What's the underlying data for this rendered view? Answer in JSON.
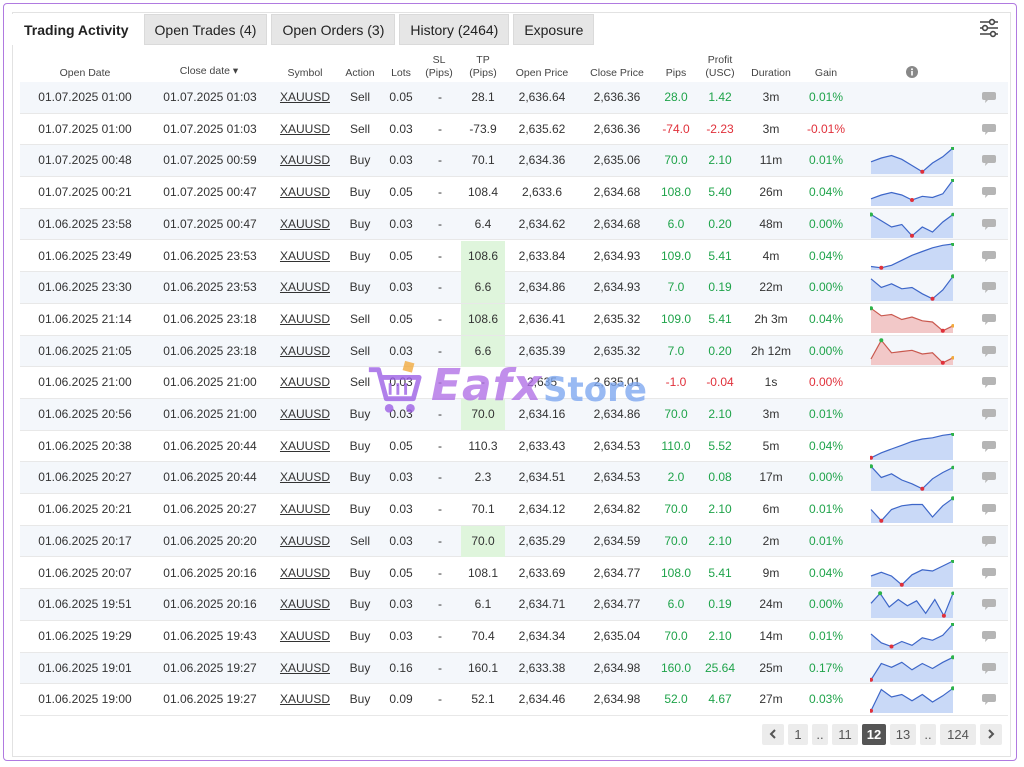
{
  "tabs": [
    {
      "label": "Trading Activity",
      "active": true
    },
    {
      "label": "Open Trades (4)",
      "active": false
    },
    {
      "label": "Open Orders (3)",
      "active": false
    },
    {
      "label": "History (2464)",
      "active": false
    },
    {
      "label": "Exposure",
      "active": false
    }
  ],
  "filter_icon": "sliders-icon",
  "columns": {
    "open_date": "Open Date",
    "close_date": "Close date ▾",
    "symbol": "Symbol",
    "action": "Action",
    "lots": "Lots",
    "sl_1": "SL",
    "sl_2": "(Pips)",
    "tp_1": "TP",
    "tp_2": "(Pips)",
    "open_price": "Open Price",
    "close_price": "Close Price",
    "pips": "Pips",
    "profit_1": "Profit",
    "profit_2": "(USC)",
    "duration": "Duration",
    "gain": "Gain",
    "info_icon": "info-icon"
  },
  "rows": [
    {
      "open": "01.07.2025 01:00",
      "close": "01.07.2025 01:03",
      "symbol": "XAUUSD",
      "action": "Sell",
      "lots": "0.05",
      "sl": "-",
      "tp": "28.1",
      "open_price": "2,636.64",
      "close_price": "2,636.36",
      "pips": "28.0",
      "profit": "1.42",
      "duration": "3m",
      "gain": "0.01%",
      "sign": "pos",
      "tp_hl": false,
      "spark": null
    },
    {
      "open": "01.07.2025 01:00",
      "close": "01.07.2025 01:03",
      "symbol": "XAUUSD",
      "action": "Sell",
      "lots": "0.03",
      "sl": "-",
      "tp": "-73.9",
      "open_price": "2,635.62",
      "close_price": "2,636.36",
      "pips": "-74.0",
      "profit": "-2.23",
      "duration": "3m",
      "gain": "-0.01%",
      "sign": "neg",
      "tp_hl": false,
      "spark": null
    },
    {
      "open": "01.07.2025 00:48",
      "close": "01.07.2025 00:59",
      "symbol": "XAUUSD",
      "action": "Buy",
      "lots": "0.03",
      "sl": "-",
      "tp": "70.1",
      "open_price": "2,634.36",
      "close_price": "2,635.06",
      "pips": "70.0",
      "profit": "2.10",
      "duration": "11m",
      "gain": "0.01%",
      "sign": "pos",
      "tp_hl": false,
      "spark": {
        "dir": "up",
        "points": [
          0.55,
          0.4,
          0.3,
          0.45,
          0.7,
          0.95,
          0.6,
          0.35,
          0.0
        ]
      }
    },
    {
      "open": "01.07.2025 00:21",
      "close": "01.07.2025 00:47",
      "symbol": "XAUUSD",
      "action": "Buy",
      "lots": "0.05",
      "sl": "-",
      "tp": "108.4",
      "open_price": "2,633.6",
      "close_price": "2,634.68",
      "pips": "108.0",
      "profit": "5.40",
      "duration": "26m",
      "gain": "0.04%",
      "sign": "pos",
      "tp_hl": false,
      "spark": {
        "dir": "up",
        "points": [
          0.75,
          0.6,
          0.5,
          0.6,
          0.8,
          0.65,
          0.7,
          0.55,
          0.0
        ]
      }
    },
    {
      "open": "01.06.2025 23:58",
      "close": "01.07.2025 00:47",
      "symbol": "XAUUSD",
      "action": "Buy",
      "lots": "0.03",
      "sl": "-",
      "tp": "6.4",
      "open_price": "2,634.62",
      "close_price": "2,634.68",
      "pips": "6.0",
      "profit": "0.20",
      "duration": "48m",
      "gain": "0.00%",
      "sign": "pos",
      "tp_hl": false,
      "spark": {
        "dir": "flat",
        "points": [
          0.1,
          0.35,
          0.6,
          0.5,
          0.95,
          0.6,
          0.8,
          0.4,
          0.1
        ]
      }
    },
    {
      "open": "01.06.2025 23:49",
      "close": "01.06.2025 23:53",
      "symbol": "XAUUSD",
      "action": "Buy",
      "lots": "0.05",
      "sl": "-",
      "tp": "108.6",
      "open_price": "2,633.84",
      "close_price": "2,634.93",
      "pips": "109.0",
      "profit": "5.41",
      "duration": "4m",
      "gain": "0.04%",
      "sign": "pos",
      "tp_hl": true,
      "spark": {
        "dir": "up",
        "points": [
          0.9,
          0.95,
          0.85,
          0.65,
          0.45,
          0.3,
          0.15,
          0.05,
          0.0
        ]
      }
    },
    {
      "open": "01.06.2025 23:30",
      "close": "01.06.2025 23:53",
      "symbol": "XAUUSD",
      "action": "Buy",
      "lots": "0.03",
      "sl": "-",
      "tp": "6.6",
      "open_price": "2,634.86",
      "close_price": "2,634.93",
      "pips": "7.0",
      "profit": "0.19",
      "duration": "22m",
      "gain": "0.00%",
      "sign": "pos",
      "tp_hl": true,
      "spark": {
        "dir": "up",
        "points": [
          0.15,
          0.5,
          0.35,
          0.55,
          0.5,
          0.75,
          0.95,
          0.6,
          0.05
        ]
      }
    },
    {
      "open": "01.06.2025 21:14",
      "close": "01.06.2025 23:18",
      "symbol": "XAUUSD",
      "action": "Sell",
      "lots": "0.05",
      "sl": "-",
      "tp": "108.6",
      "open_price": "2,636.41",
      "close_price": "2,635.32",
      "pips": "109.0",
      "profit": "5.41",
      "duration": "2h 3m",
      "gain": "0.04%",
      "sign": "pos",
      "tp_hl": true,
      "spark": {
        "dir": "down",
        "points": [
          0.05,
          0.35,
          0.3,
          0.5,
          0.4,
          0.55,
          0.6,
          0.95,
          0.75
        ]
      }
    },
    {
      "open": "01.06.2025 21:05",
      "close": "01.06.2025 23:18",
      "symbol": "XAUUSD",
      "action": "Sell",
      "lots": "0.03",
      "sl": "-",
      "tp": "6.6",
      "open_price": "2,635.39",
      "close_price": "2,635.32",
      "pips": "7.0",
      "profit": "0.20",
      "duration": "2h 12m",
      "gain": "0.00%",
      "sign": "pos",
      "tp_hl": true,
      "spark": {
        "dir": "down",
        "points": [
          0.8,
          0.05,
          0.55,
          0.5,
          0.45,
          0.6,
          0.55,
          0.95,
          0.75
        ]
      }
    },
    {
      "open": "01.06.2025 21:00",
      "close": "01.06.2025 21:00",
      "symbol": "XAUUSD",
      "action": "Sell",
      "lots": "0.03",
      "sl": "-",
      "tp": "-",
      "open_price": "2,635",
      "close_price": "2,635.01",
      "pips": "-1.0",
      "profit": "-0.04",
      "duration": "1s",
      "gain": "0.00%",
      "sign": "neg",
      "tp_hl": false,
      "spark": null
    },
    {
      "open": "01.06.2025 20:56",
      "close": "01.06.2025 21:00",
      "symbol": "XAUUSD",
      "action": "Buy",
      "lots": "0.03",
      "sl": "-",
      "tp": "70.0",
      "open_price": "2,634.16",
      "close_price": "2,634.86",
      "pips": "70.0",
      "profit": "2.10",
      "duration": "3m",
      "gain": "0.01%",
      "sign": "pos",
      "tp_hl": true,
      "spark": null
    },
    {
      "open": "01.06.2025 20:38",
      "close": "01.06.2025 20:44",
      "symbol": "XAUUSD",
      "action": "Buy",
      "lots": "0.05",
      "sl": "-",
      "tp": "110.3",
      "open_price": "2,633.43",
      "close_price": "2,634.53",
      "pips": "110.0",
      "profit": "5.52",
      "duration": "5m",
      "gain": "0.04%",
      "sign": "pos",
      "tp_hl": false,
      "spark": {
        "dir": "up",
        "points": [
          0.95,
          0.75,
          0.6,
          0.45,
          0.3,
          0.2,
          0.15,
          0.05,
          0.0
        ]
      }
    },
    {
      "open": "01.06.2025 20:27",
      "close": "01.06.2025 20:44",
      "symbol": "XAUUSD",
      "action": "Buy",
      "lots": "0.03",
      "sl": "-",
      "tp": "2.3",
      "open_price": "2,634.51",
      "close_price": "2,634.53",
      "pips": "2.0",
      "profit": "0.08",
      "duration": "17m",
      "gain": "0.00%",
      "sign": "pos",
      "tp_hl": false,
      "spark": {
        "dir": "flat",
        "points": [
          0.05,
          0.5,
          0.35,
          0.6,
          0.75,
          0.95,
          0.55,
          0.3,
          0.1
        ]
      }
    },
    {
      "open": "01.06.2025 20:21",
      "close": "01.06.2025 20:27",
      "symbol": "XAUUSD",
      "action": "Buy",
      "lots": "0.03",
      "sl": "-",
      "tp": "70.1",
      "open_price": "2,634.12",
      "close_price": "2,634.82",
      "pips": "70.0",
      "profit": "2.10",
      "duration": "6m",
      "gain": "0.01%",
      "sign": "pos",
      "tp_hl": false,
      "spark": {
        "dir": "up",
        "points": [
          0.5,
          0.95,
          0.5,
          0.35,
          0.3,
          0.3,
          0.8,
          0.35,
          0.05
        ]
      }
    },
    {
      "open": "01.06.2025 20:17",
      "close": "01.06.2025 20:20",
      "symbol": "XAUUSD",
      "action": "Sell",
      "lots": "0.03",
      "sl": "-",
      "tp": "70.0",
      "open_price": "2,635.29",
      "close_price": "2,634.59",
      "pips": "70.0",
      "profit": "2.10",
      "duration": "2m",
      "gain": "0.01%",
      "sign": "pos",
      "tp_hl": true,
      "spark": null
    },
    {
      "open": "01.06.2025 20:07",
      "close": "01.06.2025 20:16",
      "symbol": "XAUUSD",
      "action": "Buy",
      "lots": "0.05",
      "sl": "-",
      "tp": "108.1",
      "open_price": "2,633.69",
      "close_price": "2,634.77",
      "pips": "108.0",
      "profit": "5.41",
      "duration": "9m",
      "gain": "0.04%",
      "sign": "pos",
      "tp_hl": false,
      "spark": {
        "dir": "up",
        "points": [
          0.6,
          0.45,
          0.6,
          0.95,
          0.55,
          0.35,
          0.4,
          0.2,
          0.0
        ]
      }
    },
    {
      "open": "01.06.2025 19:51",
      "close": "01.06.2025 20:16",
      "symbol": "XAUUSD",
      "action": "Buy",
      "lots": "0.03",
      "sl": "-",
      "tp": "6.1",
      "open_price": "2,634.71",
      "close_price": "2,634.77",
      "pips": "6.0",
      "profit": "0.19",
      "duration": "24m",
      "gain": "0.00%",
      "sign": "pos",
      "tp_hl": false,
      "spark": {
        "dir": "flat",
        "points": [
          0.45,
          0.05,
          0.6,
          0.3,
          0.55,
          0.35,
          0.85,
          0.3,
          0.95,
          0.05
        ]
      }
    },
    {
      "open": "01.06.2025 19:29",
      "close": "01.06.2025 19:43",
      "symbol": "XAUUSD",
      "action": "Buy",
      "lots": "0.03",
      "sl": "-",
      "tp": "70.4",
      "open_price": "2,634.34",
      "close_price": "2,635.04",
      "pips": "70.0",
      "profit": "2.10",
      "duration": "14m",
      "gain": "0.01%",
      "sign": "pos",
      "tp_hl": false,
      "spark": {
        "dir": "up",
        "points": [
          0.4,
          0.75,
          0.9,
          0.7,
          0.85,
          0.55,
          0.65,
          0.45,
          0.0
        ]
      }
    },
    {
      "open": "01.06.2025 19:01",
      "close": "01.06.2025 19:27",
      "symbol": "XAUUSD",
      "action": "Buy",
      "lots": "0.16",
      "sl": "-",
      "tp": "160.1",
      "open_price": "2,633.38",
      "close_price": "2,634.98",
      "pips": "160.0",
      "profit": "25.64",
      "duration": "25m",
      "gain": "0.17%",
      "sign": "pos",
      "tp_hl": false,
      "spark": {
        "dir": "up",
        "points": [
          0.95,
          0.3,
          0.45,
          0.25,
          0.55,
          0.3,
          0.5,
          0.25,
          0.05
        ]
      }
    },
    {
      "open": "01.06.2025 19:00",
      "close": "01.06.2025 19:27",
      "symbol": "XAUUSD",
      "action": "Buy",
      "lots": "0.09",
      "sl": "-",
      "tp": "52.1",
      "open_price": "2,634.46",
      "close_price": "2,634.98",
      "pips": "52.0",
      "profit": "4.67",
      "duration": "27m",
      "gain": "0.03%",
      "sign": "pos",
      "tp_hl": false,
      "spark": {
        "dir": "flat",
        "points": [
          0.95,
          0.1,
          0.4,
          0.3,
          0.55,
          0.3,
          0.6,
          0.35,
          0.05
        ]
      }
    }
  ],
  "pagination": {
    "prev_icon": "chevron-left-icon",
    "next_icon": "chevron-right-icon",
    "items": [
      "1",
      "..",
      "11",
      "12",
      "13",
      "..",
      "124"
    ],
    "current": "12"
  },
  "watermark": {
    "text_main": "Eafx",
    "text_sub": "Store",
    "icon": "cart-icon"
  },
  "colors": {
    "positive": "#1fa34a",
    "negative": "#e0303a",
    "spark_up_fill": "#c9d9f7",
    "spark_up_line": "#3d66c8",
    "spark_down_fill": "#f2c8c8",
    "spark_down_line": "#c9584e",
    "tp_highlight": "#dff5dc",
    "frame": "#b07ae0"
  }
}
